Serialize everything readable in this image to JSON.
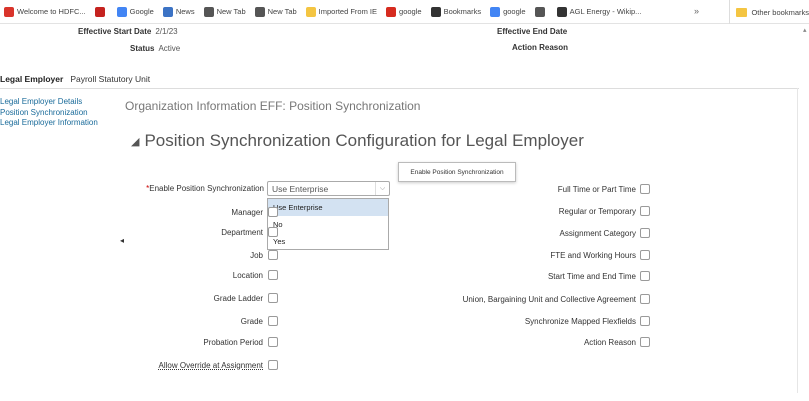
{
  "bookmarks": [
    {
      "label": "Welcome to HDFC...",
      "icon": "hdfc-icon",
      "color": "#d9342b"
    },
    {
      "label": "",
      "icon": "gmail-icon",
      "color": "#c5221f"
    },
    {
      "label": "Google",
      "icon": "google-icon",
      "color": "#4285f4"
    },
    {
      "label": "News",
      "icon": "news-icon",
      "color": "#3c73c5"
    },
    {
      "label": "New Tab",
      "icon": "globe-icon",
      "color": "#555555"
    },
    {
      "label": "New Tab",
      "icon": "globe-icon",
      "color": "#555555"
    },
    {
      "label": "Imported From IE",
      "icon": "folder-icon",
      "color": "#f4c542"
    },
    {
      "label": "google",
      "icon": "opera-icon",
      "color": "#d62b1f"
    },
    {
      "label": "Bookmarks",
      "icon": "star-icon",
      "color": "#333333"
    },
    {
      "label": "google",
      "icon": "google-icon",
      "color": "#4285f4"
    },
    {
      "label": "",
      "icon": "globe-icon",
      "color": "#555555"
    },
    {
      "label": "AGL Energy - Wikip...",
      "icon": "wikipedia-icon",
      "color": "#333333"
    }
  ],
  "bookmarks_more": "»",
  "other_bookmarks": "Other bookmarks",
  "header": {
    "start_label": "Effective Start Date",
    "start_value": "2/1/23",
    "status_label": "Status",
    "status_value": "Active",
    "end_label": "Effective End Date",
    "reason_label": "Action Reason"
  },
  "tabs": [
    "Legal Employer",
    "Payroll Statutory Unit"
  ],
  "leftnav": [
    "Legal Employer Details",
    "Position Synchronization",
    "Legal Employer Information"
  ],
  "page_title": "Organization Information EFF: Position Synchronization",
  "section_title": "Position Synchronization Configuration for Legal Employer",
  "section_triangle": "◢",
  "tooltip": "Enable Position Synchronization",
  "enable_field": {
    "required_mark": "*",
    "label": "Enable Position Synchronization",
    "value": "Use Enterprise",
    "chevron": "⌵",
    "options": [
      "Use Enterprise",
      "No",
      "Yes"
    ],
    "selected_index": 0
  },
  "left_fields": [
    "Manager",
    "Department",
    "Job",
    "Location",
    "Grade Ladder",
    "Grade",
    "Probation Period",
    "Allow Override at Assignment"
  ],
  "right_fields": [
    "Full Time or Part Time",
    "Regular or Temporary",
    "Assignment Category",
    "FTE and Working Hours",
    "Start Time and End Time",
    "Union, Bargaining Unit and Collective Agreement",
    "Synchronize Mapped Flexfields",
    "Action Reason"
  ],
  "collapse_glyph": "◂"
}
